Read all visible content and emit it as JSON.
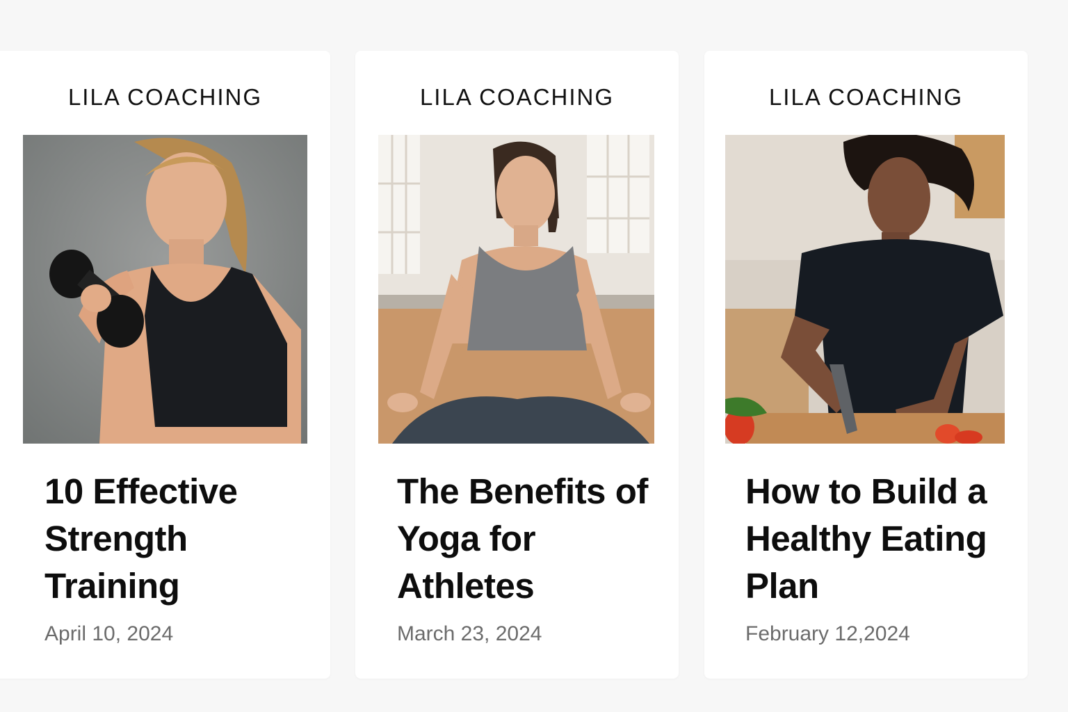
{
  "cards": [
    {
      "brand": "LILA COACHING",
      "image_alt": "Woman lifting a dumbbell",
      "title": "10 Effective Strength Training",
      "date": "April 10, 2024"
    },
    {
      "brand": "LILA COACHING",
      "image_alt": "Woman meditating in a yoga pose",
      "title": "The Benefits of Yoga for Athletes",
      "date": "March 23, 2024"
    },
    {
      "brand": "LILA COACHING",
      "image_alt": "Woman chopping vegetables",
      "title": "How to Build a Healthy Eating Plan",
      "date": "February 12,2024"
    }
  ]
}
